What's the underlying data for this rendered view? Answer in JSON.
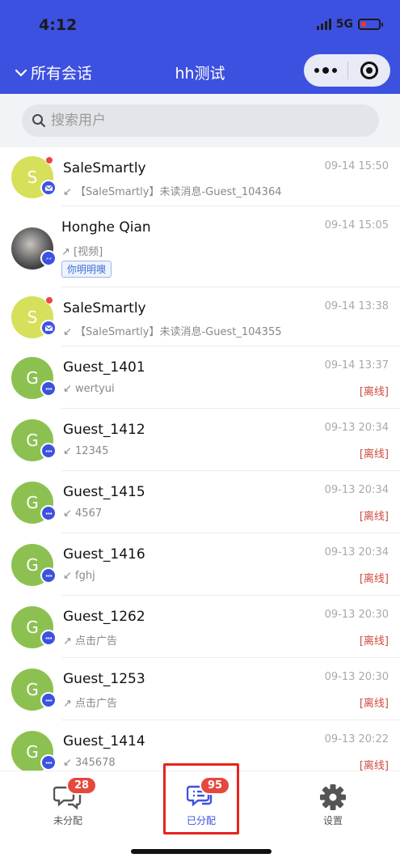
{
  "status_bar": {
    "time": "4:12",
    "network": "5G"
  },
  "nav": {
    "back_label": "所有会话",
    "title": "hh测试"
  },
  "search": {
    "placeholder": "搜索用户"
  },
  "conversations": [
    {
      "name": "SaleSmartly",
      "initial": "S",
      "time": "09-14 15:50",
      "preview": "↙ 【SaleSmartly】未读消息-Guest_104364",
      "channel": "email-icon",
      "unread": true
    },
    {
      "name": "Honghe Qian",
      "initial": "",
      "time": "09-14 15:05",
      "preview": "↗ [视频]",
      "tag": "你明明噢",
      "channel": "messenger-icon"
    },
    {
      "name": "SaleSmartly",
      "initial": "S",
      "time": "09-14 13:38",
      "preview": "↙ 【SaleSmartly】未读消息-Guest_104355",
      "channel": "email-icon",
      "unread": true
    },
    {
      "name": "Guest_1401",
      "initial": "G",
      "time": "09-14 13:37",
      "preview": "↙ wertyui",
      "status": "[离线]",
      "channel": "chat-icon"
    },
    {
      "name": "Guest_1412",
      "initial": "G",
      "time": "09-13 20:34",
      "preview": "↙ 12345",
      "status": "[离线]",
      "channel": "chat-icon"
    },
    {
      "name": "Guest_1415",
      "initial": "G",
      "time": "09-13 20:34",
      "preview": "↙ 4567",
      "status": "[离线]",
      "channel": "chat-icon"
    },
    {
      "name": "Guest_1416",
      "initial": "G",
      "time": "09-13 20:34",
      "preview": "↙ fghj",
      "status": "[离线]",
      "channel": "chat-icon"
    },
    {
      "name": "Guest_1262",
      "initial": "G",
      "time": "09-13 20:30",
      "preview": "↗ 点击广告",
      "status": "[离线]",
      "channel": "chat-icon"
    },
    {
      "name": "Guest_1253",
      "initial": "G",
      "time": "09-13 20:30",
      "preview": "↗ 点击广告",
      "status": "[离线]",
      "channel": "chat-icon"
    },
    {
      "name": "Guest_1414",
      "initial": "G",
      "time": "09-13 20:22",
      "preview": "↙ 345678",
      "status": "[离线]",
      "channel": "chat-icon"
    }
  ],
  "tabs": [
    {
      "label": "未分配",
      "badge": "28",
      "icon": "chat-bubbles-icon"
    },
    {
      "label": "已分配",
      "badge": "95",
      "icon": "chat-list-icon",
      "active": true
    },
    {
      "label": "设置",
      "icon": "gear-icon"
    }
  ],
  "colors": {
    "brand": "#3d51e0",
    "badge": "#e5483f",
    "offline": "#d04a3c",
    "highlight": "#e8231d"
  }
}
